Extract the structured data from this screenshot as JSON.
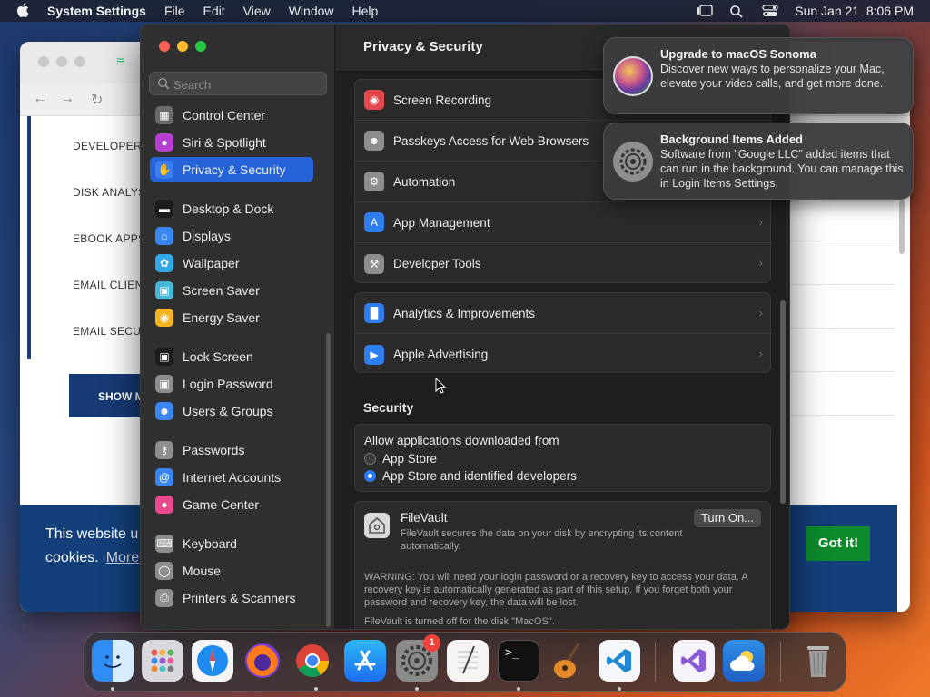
{
  "menubar": {
    "app_name": "System Settings",
    "menus": [
      "File",
      "Edit",
      "View",
      "Window",
      "Help"
    ],
    "clock": "Sun Jan 21  8:06 PM"
  },
  "browser": {
    "sidebar_items": [
      "DEVELOPER T",
      "DISK ANALYS",
      "EBOOK APPS",
      "EMAIL CLIENT",
      "EMAIL SECUR"
    ],
    "show_more_label": "SHOW M",
    "cookie_line1": "This website u",
    "cookie_line2": "cookies.",
    "cookie_more": "More",
    "cookie_button": "Got it!"
  },
  "settings": {
    "search_placeholder": "Search",
    "nav_items": [
      {
        "label": "Control Center",
        "icon": "control-center-icon",
        "color": "#6b6b6b"
      },
      {
        "label": "Siri & Spotlight",
        "icon": "siri-icon",
        "color": "#b63fd1"
      },
      {
        "label": "Privacy & Security",
        "icon": "hand-icon",
        "color": "#3a7ef2"
      },
      {
        "label": "Desktop & Dock",
        "icon": "dock-icon",
        "color": "#1c1c1c"
      },
      {
        "label": "Displays",
        "icon": "sun-icon",
        "color": "#3a86f0"
      },
      {
        "label": "Wallpaper",
        "icon": "flower-icon",
        "color": "#33a9e8"
      },
      {
        "label": "Screen Saver",
        "icon": "screen-saver-icon",
        "color": "#47b7d8"
      },
      {
        "label": "Energy Saver",
        "icon": "bulb-icon",
        "color": "#f4b521"
      },
      {
        "label": "Lock Screen",
        "icon": "lock-icon",
        "color": "#1c1c1c"
      },
      {
        "label": "Login Password",
        "icon": "lock-icon",
        "color": "#8e8e8e"
      },
      {
        "label": "Users & Groups",
        "icon": "users-icon",
        "color": "#3a86f0"
      },
      {
        "label": "Passwords",
        "icon": "key-icon",
        "color": "#8e8e8e"
      },
      {
        "label": "Internet Accounts",
        "icon": "at-icon",
        "color": "#3a86f0"
      },
      {
        "label": "Game Center",
        "icon": "game-center-icon",
        "color": "#e84a8d"
      },
      {
        "label": "Keyboard",
        "icon": "keyboard-icon",
        "color": "#8e8e8e"
      },
      {
        "label": "Mouse",
        "icon": "mouse-icon",
        "color": "#8e8e8e"
      },
      {
        "label": "Printers & Scanners",
        "icon": "printer-icon",
        "color": "#8e8e8e"
      }
    ],
    "page_title": "Privacy & Security",
    "group1": [
      {
        "label": "Screen Recording",
        "icon": "record-icon",
        "color": "#e5484d"
      },
      {
        "label": "Passkeys Access for Web Browsers",
        "icon": "person-icon",
        "color": "#8e8e8e"
      },
      {
        "label": "Automation",
        "icon": "gear-icon",
        "color": "#8e8e8e"
      },
      {
        "label": "App Management",
        "icon": "app-store-icon",
        "color": "#2f7ef0"
      },
      {
        "label": "Developer Tools",
        "icon": "hammer-icon",
        "color": "#8e8e8e"
      }
    ],
    "group2": [
      {
        "label": "Analytics & Improvements",
        "icon": "chart-icon",
        "color": "#2f7ef0"
      },
      {
        "label": "Apple Advertising",
        "icon": "megaphone-icon",
        "color": "#2f7ef0"
      }
    ],
    "security_title": "Security",
    "allow_label": "Allow applications downloaded from",
    "radio_options": [
      {
        "label": "App Store",
        "selected": false
      },
      {
        "label": "App Store and identified developers",
        "selected": true
      }
    ],
    "filevault": {
      "title": "FileVault",
      "description": "FileVault secures the data on your disk by encrypting its content automatically.",
      "button": "Turn On...",
      "warning": "WARNING: You will need your login password or a recovery key to access your data. A recovery key is automatically generated as part of this setup. If you forget both your password and recovery key, the data will be lost.",
      "status": "FileVault is turned off for the disk \"MacOS\"."
    }
  },
  "notifications": [
    {
      "title": "Upgrade to macOS Sonoma",
      "body": "Discover new ways to personalize your Mac, elevate your video calls, and get more done.",
      "icon": "sonoma-icon"
    },
    {
      "title": "Background Items Added",
      "body": "Software from \"Google LLC\" added items that can run in the background. You can manage this in Login Items Settings.",
      "icon": "settings-gear-icon"
    }
  ],
  "dock": {
    "apps": [
      "Finder",
      "Launchpad",
      "Safari",
      "Firefox",
      "Chrome",
      "App Store",
      "System Settings",
      "TextEdit",
      "Terminal",
      "GarageBand",
      "VS Code",
      "Visual Studio",
      "Weather",
      "Trash"
    ],
    "settings_badge": "1"
  }
}
